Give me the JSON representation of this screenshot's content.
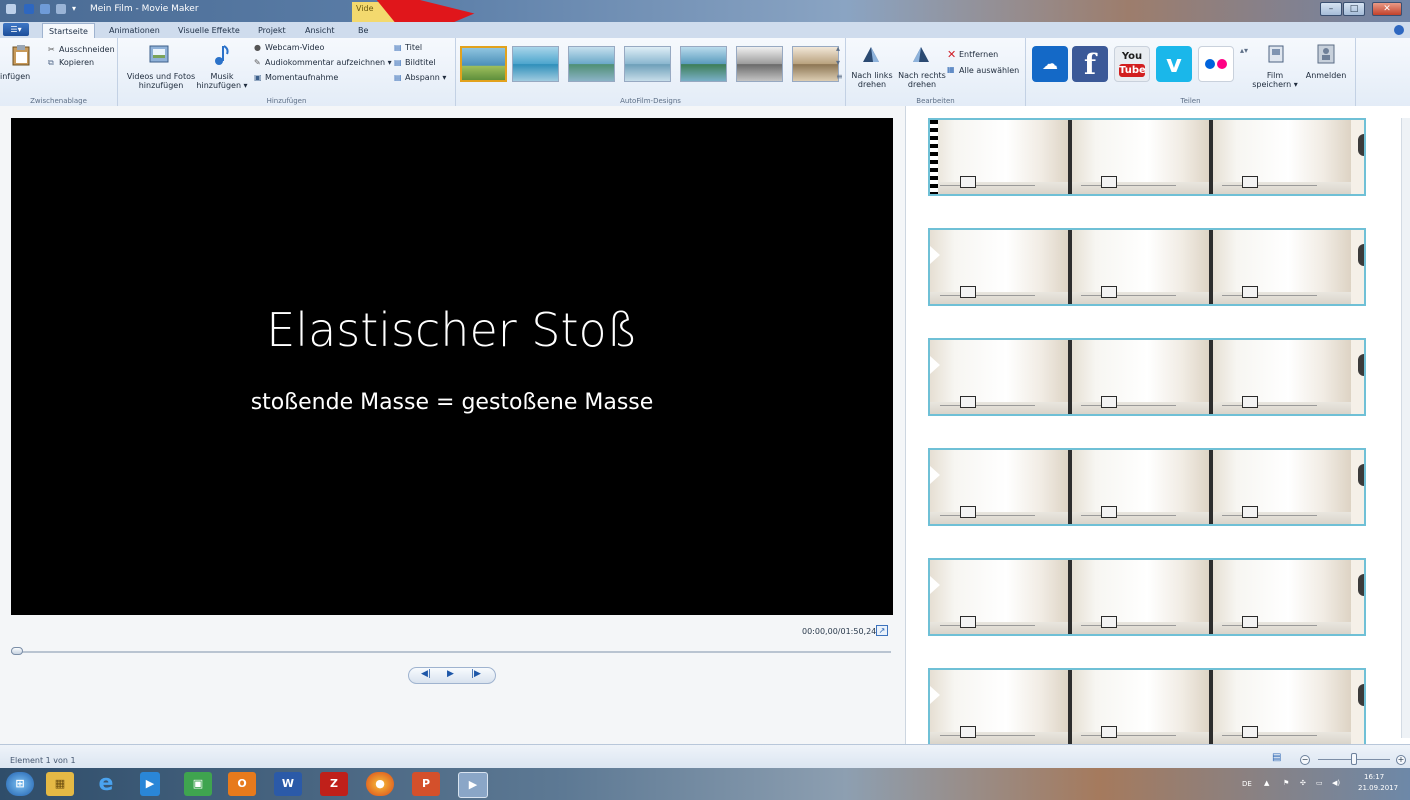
{
  "window": {
    "title": "Mein Film - Movie Maker",
    "context_tab": "Vide"
  },
  "tabs": [
    "Startseite",
    "Animationen",
    "Visuelle Effekte",
    "Projekt",
    "Ansicht",
    "Be"
  ],
  "ribbon": {
    "clipboard": {
      "paste": "infügen",
      "cut": "Ausschneiden",
      "copy": "Kopieren",
      "group": "Zwischenablage"
    },
    "add": {
      "videos_photos_1": "Videos und Fotos",
      "videos_photos_2": "hinzufügen",
      "music_1": "Musik",
      "music_2": "hinzufügen ▾",
      "webcam": "Webcam-Video",
      "narration": "Audiokommentar aufzeichnen ▾",
      "snapshot": "Momentaufnahme",
      "title": "Titel",
      "caption": "Bildtitel",
      "credits": "Abspann ▾",
      "group": "Hinzufügen"
    },
    "themes": {
      "group": "AutoFilm-Designs",
      "items": [
        "design-default",
        "design-contemporary",
        "design-cinematic",
        "design-fade",
        "design-pan-zoom",
        "design-black-white",
        "design-sepia"
      ]
    },
    "edit": {
      "rotate_left_1": "Nach links",
      "rotate_left_2": "drehen",
      "rotate_right_1": "Nach rechts",
      "rotate_right_2": "drehen",
      "remove": "Entfernen",
      "select_all": "Alle auswählen",
      "group": "Bearbeiten"
    },
    "share": {
      "group": "Teilen",
      "save_1": "Film",
      "save_2": "speichern ▾",
      "signin": "Anmelden",
      "services": [
        "OneDrive",
        "Facebook",
        "YouTube",
        "Vimeo",
        "Flickr"
      ]
    }
  },
  "preview": {
    "title": "Elastischer Stoß",
    "subtitle": "stoßende Masse = gestoßene Masse",
    "timecode": "00:00,00/01:50,24",
    "progress_fraction": 0.0
  },
  "storyboard": {
    "rows": 6,
    "frames_per_row": 3
  },
  "status": {
    "text": "Element 1 von 1"
  },
  "tray": {
    "lang": "DE",
    "time": "16:17",
    "date": "21.09.2017"
  },
  "colors": {
    "accent": "#2d66b3",
    "strip_border": "#6fc0d6",
    "annotation_arrow": "#e0161b",
    "selected_theme": "#e2a21d"
  }
}
